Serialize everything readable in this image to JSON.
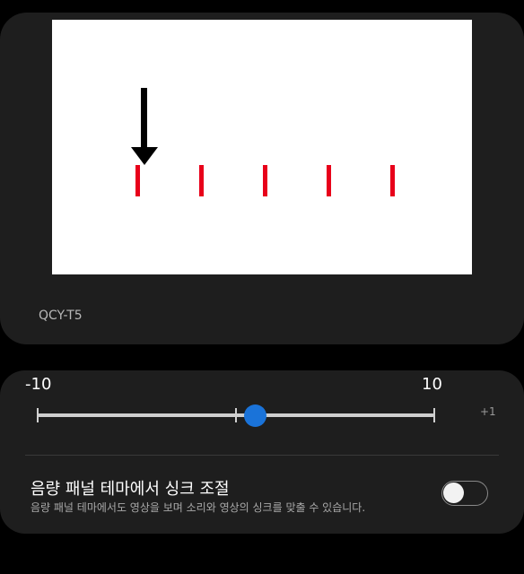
{
  "preview": {
    "device_name": "QCY-T5",
    "markers_count": 5,
    "arrow_target_index": 0,
    "marker_color": "#e8001a"
  },
  "slider": {
    "min_label": "-10",
    "max_label": "10",
    "value_label": "+1",
    "value": 1,
    "min": -10,
    "max": 10,
    "accent": "#1a73d9"
  },
  "sync_setting": {
    "title": "음량 패널 테마에서 싱크 조절",
    "description": "음량 패널 테마에서도 영상을 보며 소리와 영상의 싱크를 맞출 수 있습니다.",
    "enabled": false
  }
}
